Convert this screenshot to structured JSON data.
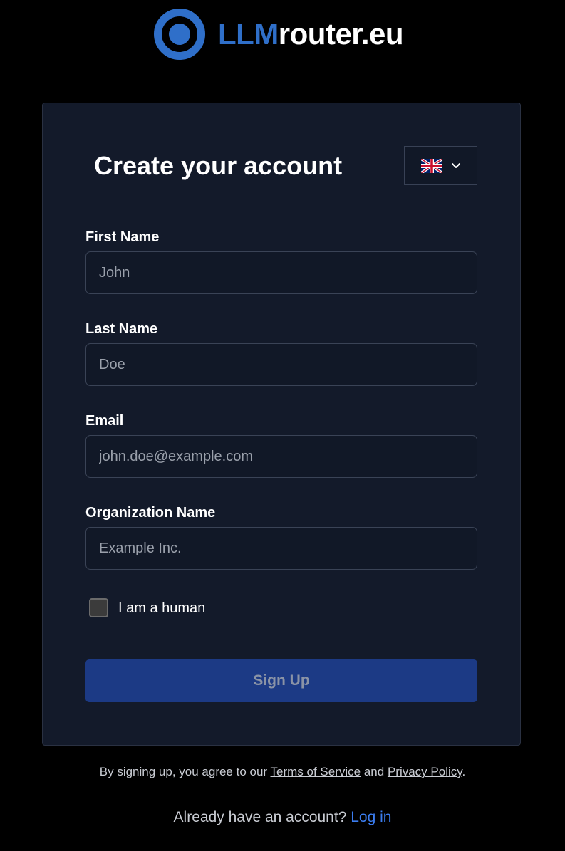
{
  "brand": {
    "logo_part1": "LLM",
    "logo_part2": "router.eu",
    "brand_color": "#2f6fc9"
  },
  "form": {
    "title": "Create your account",
    "language": {
      "icon": "uk-flag-icon",
      "dropdown_icon": "chevron-down-icon"
    },
    "fields": {
      "first_name": {
        "label": "First Name",
        "placeholder": "John",
        "value": ""
      },
      "last_name": {
        "label": "Last Name",
        "placeholder": "Doe",
        "value": ""
      },
      "email": {
        "label": "Email",
        "placeholder": "john.doe@example.com",
        "value": ""
      },
      "organization": {
        "label": "Organization Name",
        "placeholder": "Example Inc.",
        "value": ""
      }
    },
    "captcha": {
      "label": "I am a human",
      "checked": false
    },
    "submit_label": "Sign Up"
  },
  "footer": {
    "terms_prefix": "By signing up, you agree to our",
    "terms_link": "Terms of Service",
    "terms_and": "and",
    "privacy_link": "Privacy Policy",
    "terms_suffix": ".",
    "account_prompt": "Already have an account?",
    "login_link": "Log in"
  },
  "colors": {
    "background": "#000000",
    "card": "#131a2a",
    "input": "#111827",
    "button": "#1c3a85",
    "link": "#3b7df0"
  }
}
